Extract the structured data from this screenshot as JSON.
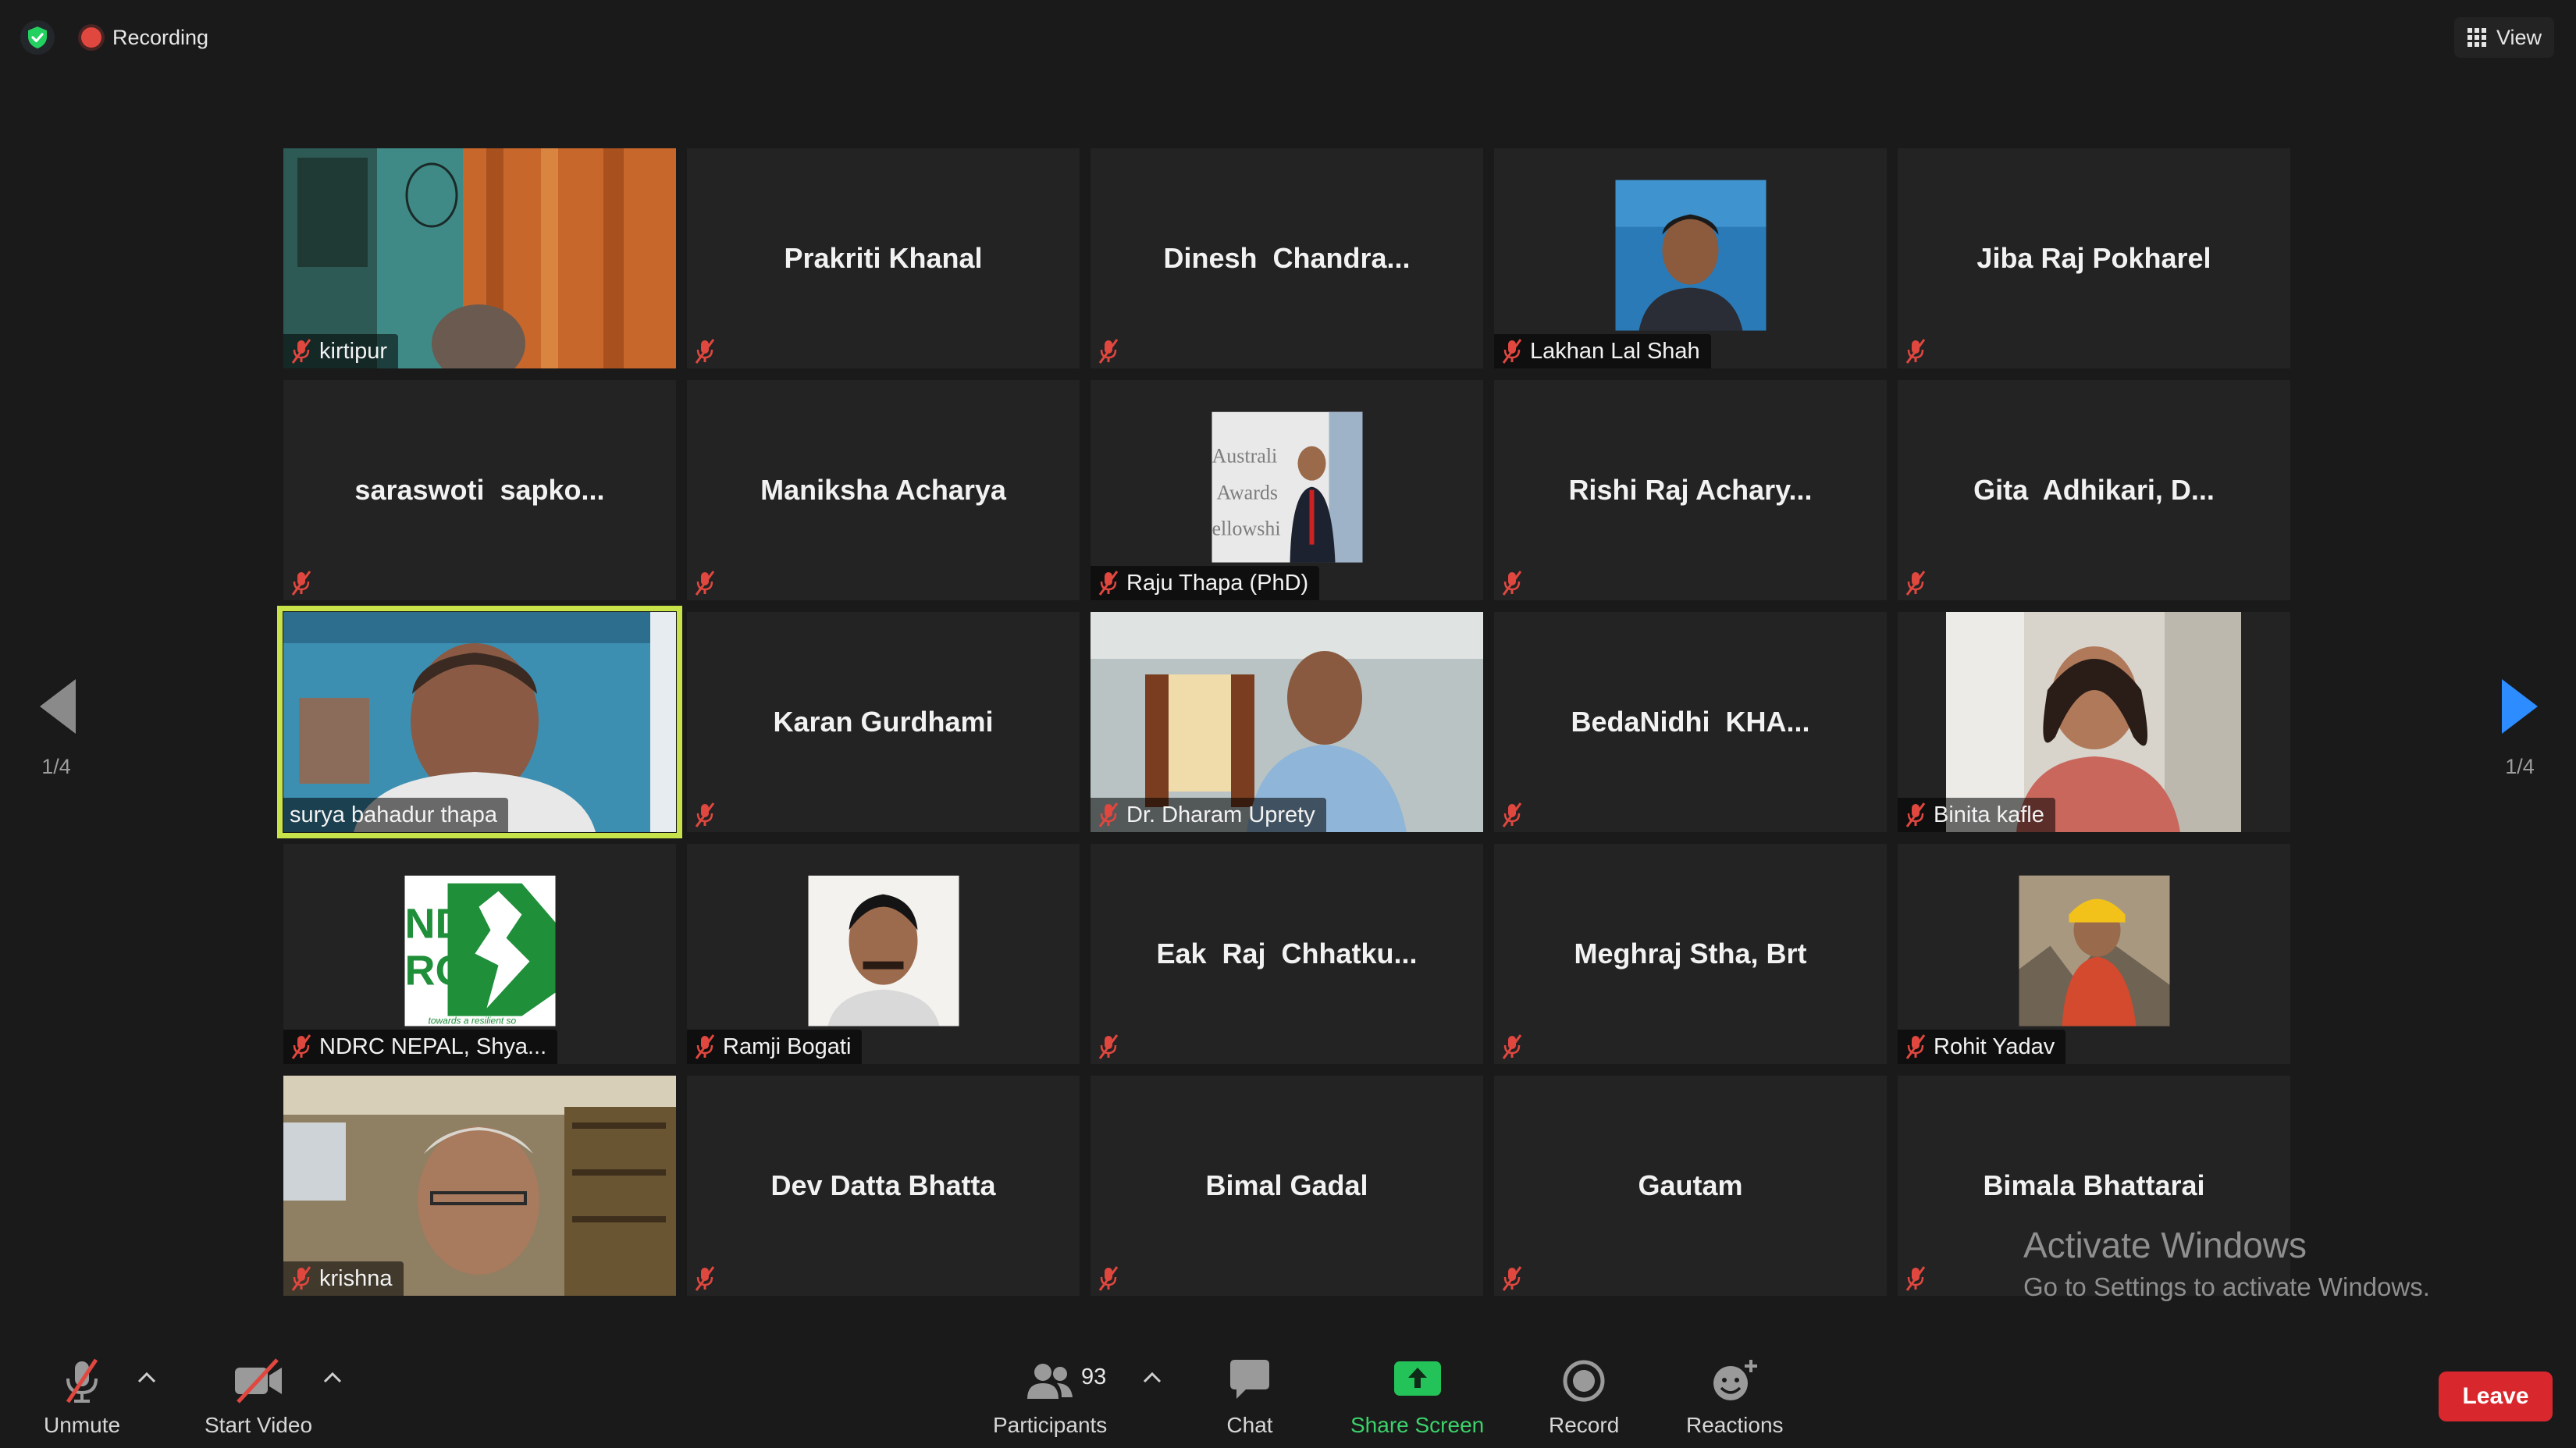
{
  "top_bar": {
    "recording_label": "Recording",
    "view_label": "View"
  },
  "pagination": {
    "left": "1/4",
    "right": "1/4"
  },
  "participants": [
    {
      "name": "kirtipur",
      "display": "video"
    },
    {
      "name": "Prakriti Khanal",
      "display": "name"
    },
    {
      "name": "Dinesh  Chandra...",
      "display": "name"
    },
    {
      "name": "Lakhan Lal Shah",
      "display": "photo"
    },
    {
      "name": "Jiba Raj Pokharel",
      "display": "name"
    },
    {
      "name": "saraswoti  sapko...",
      "display": "name"
    },
    {
      "name": "Maniksha Acharya",
      "display": "name"
    },
    {
      "name": "Raju Thapa (PhD)",
      "display": "photo",
      "photo_text": [
        "Australi",
        "Awards",
        "ellowshi"
      ]
    },
    {
      "name": "Rishi Raj Achary...",
      "display": "name"
    },
    {
      "name": "Gita  Adhikari, D...",
      "display": "name"
    },
    {
      "name": "surya bahadur thapa",
      "display": "video",
      "active_speaker": true
    },
    {
      "name": "Karan Gurdhami",
      "display": "name"
    },
    {
      "name": "Dr. Dharam Uprety",
      "display": "video"
    },
    {
      "name": "BedaNidhi  KHA...",
      "display": "name"
    },
    {
      "name": "Binita kafle",
      "display": "video"
    },
    {
      "name": "NDRC NEPAL, Shya...",
      "display": "photo",
      "photo_text": [
        "ND",
        "RC",
        "towards a resilient so"
      ]
    },
    {
      "name": "Ramji Bogati",
      "display": "photo"
    },
    {
      "name": "Eak  Raj  Chhatku...",
      "display": "name"
    },
    {
      "name": "Meghraj Stha, Brt",
      "display": "name"
    },
    {
      "name": "Rohit Yadav",
      "display": "photo"
    },
    {
      "name": "krishna",
      "display": "video"
    },
    {
      "name": "Dev Datta Bhatta",
      "display": "name"
    },
    {
      "name": "Bimal Gadal",
      "display": "name"
    },
    {
      "name": "Gautam",
      "display": "name"
    },
    {
      "name": "Bimala Bhattarai",
      "display": "name"
    }
  ],
  "toolbar": {
    "unmute": "Unmute",
    "start_video": "Start Video",
    "participants": "Participants",
    "participant_count": "93",
    "chat": "Chat",
    "share_screen": "Share Screen",
    "record": "Record",
    "reactions": "Reactions",
    "leave": "Leave"
  },
  "watermark": {
    "title": "Activate Windows",
    "subtitle": "Go to Settings to activate Windows."
  },
  "colors": {
    "background": "#1a1a1a",
    "tile": "#232323",
    "active_speaker_border": "#c8e34a",
    "share_screen": "#3cd16a",
    "leave": "#d9272e",
    "muted_mic": "#e0473f",
    "nav_arrow_right": "#2d8cff"
  }
}
